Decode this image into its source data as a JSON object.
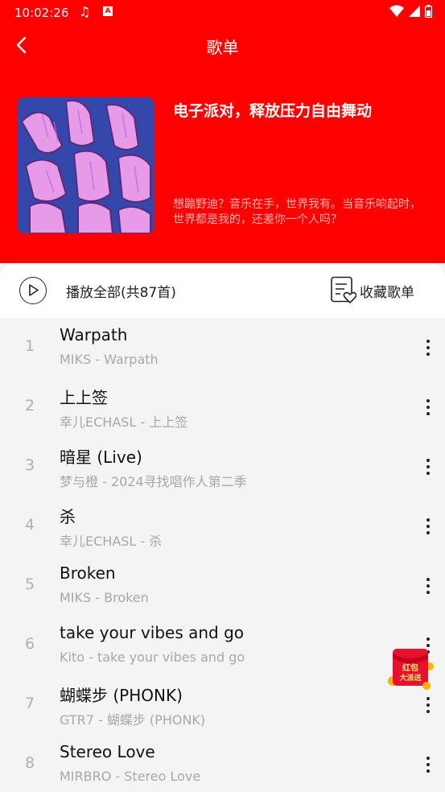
{
  "status_bar": {
    "time": "10:02:26"
  },
  "appbar": {
    "title": "歌单"
  },
  "playlist": {
    "name": "电子派对，释放压力自由舞动",
    "description": "想蹦野迪？音乐在手，世界我有。当音乐响起时，世界都是我的，还差你一个人吗？"
  },
  "actions": {
    "play_all": "播放全部(共87首)",
    "favorite": "收藏歌单"
  },
  "songs": [
    {
      "index": "1",
      "title": "Warpath",
      "subtitle": "MIKS - Warpath"
    },
    {
      "index": "2",
      "title": "上上签",
      "subtitle": "幸儿ECHASL - 上上签"
    },
    {
      "index": "3",
      "title": "暗星 (Live)",
      "subtitle": "梦与橙 - 2024寻找唱作人第二季"
    },
    {
      "index": "4",
      "title": "杀",
      "subtitle": "幸儿ECHASL - 杀"
    },
    {
      "index": "5",
      "title": "Broken",
      "subtitle": "MIKS - Broken"
    },
    {
      "index": "6",
      "title": "take your vibes and go",
      "subtitle": "Kito - take your vibes and go"
    },
    {
      "index": "7",
      "title": "蝴蝶步 (PHONK)",
      "subtitle": "GTR7 - 蝴蝶步 (PHONK)"
    },
    {
      "index": "8",
      "title": "Stereo Love",
      "subtitle": "MIRBRO - Stereo Love"
    }
  ],
  "promo": {
    "line1": "红包",
    "line2": "大派送"
  },
  "colors": {
    "header_bg": "#ff0000",
    "page_bg": "#f4f4f4"
  },
  "icons": [
    "back-arrow-icon",
    "play-circle-icon",
    "favorite-playlist-icon",
    "more-vertical-icon",
    "wifi-icon",
    "signal-icon",
    "battery-icon",
    "music-note-icon"
  ]
}
